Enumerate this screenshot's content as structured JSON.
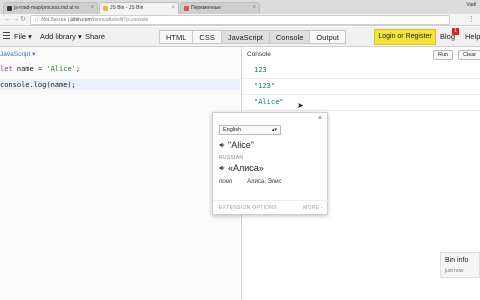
{
  "browser": {
    "tabs": [
      {
        "label": "js-road-map/process.md at m",
        "favicon_color": "#333333",
        "active": false
      },
      {
        "label": "JS Bin - JS Bin",
        "favicon_color": "#e8b93a",
        "active": true
      },
      {
        "label": "Переменные",
        "favicon_color": "#d9534f",
        "active": false
      }
    ],
    "user": "Vadi",
    "security": "Not Secure",
    "url_host": "jsbin.com",
    "url_path": "/tenocaAs/edit?js,console"
  },
  "toolbar": {
    "file_label": "File",
    "add_library_label": "Add library",
    "share_label": "Share",
    "panels": [
      {
        "label": "HTML",
        "active": false
      },
      {
        "label": "CSS",
        "active": false
      },
      {
        "label": "JavaScript",
        "active": true
      },
      {
        "label": "Console",
        "active": true
      },
      {
        "label": "Output",
        "active": false
      }
    ],
    "login_label": "Login or Register",
    "blog_label": "Blog",
    "blog_badge": "1",
    "help_label": "Help"
  },
  "editor": {
    "language_label": "JavaScript",
    "code_lines": [
      {
        "kw": "let",
        "rest": " name = ",
        "str": "'Alice'",
        "end": ";"
      },
      {
        "kw": "",
        "rest": "console.log(name);",
        "str": "",
        "end": ""
      }
    ]
  },
  "console": {
    "title": "Console",
    "run_label": "Run",
    "clear_label": "Clear",
    "lines": [
      "123",
      "\"123\"",
      "\"Alice\""
    ]
  },
  "translate_popup": {
    "source_language": "English",
    "source_word": "\"Alice\"",
    "target_language": "RUSSIAN",
    "translation": "«Алиса»",
    "part_of_speech": "noun",
    "variants": "Алиса, Элис",
    "options_label": "EXTENSION OPTIONS",
    "more_label": "MORE ›",
    "close_label": "×"
  },
  "bin_info": {
    "title": "Bin info",
    "subtitle": "just now"
  }
}
